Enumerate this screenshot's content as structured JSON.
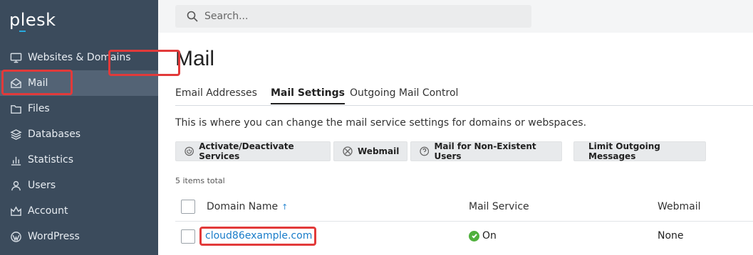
{
  "app": {
    "logo": "plesk"
  },
  "sidebar": {
    "items": [
      {
        "label": "Websites & Domains",
        "icon": "monitor-icon"
      },
      {
        "label": "Mail",
        "icon": "mail-icon",
        "active": true
      },
      {
        "label": "Files",
        "icon": "folder-icon"
      },
      {
        "label": "Databases",
        "icon": "database-icon"
      },
      {
        "label": "Statistics",
        "icon": "bar-chart-icon"
      },
      {
        "label": "Users",
        "icon": "user-icon"
      },
      {
        "label": "Account",
        "icon": "account-icon"
      },
      {
        "label": "WordPress",
        "icon": "wordpress-icon"
      }
    ]
  },
  "search": {
    "placeholder": "Search..."
  },
  "page": {
    "title": "Mail",
    "tabs": [
      {
        "label": "Email Addresses"
      },
      {
        "label": "Mail Settings",
        "active": true
      },
      {
        "label": "Outgoing Mail Control"
      }
    ],
    "description": "This is where you can change the mail service settings for domains or webspaces.",
    "toolbar": {
      "activate": "Activate/Deactivate Services",
      "webmail": "Webmail",
      "nonexistent": "Mail for Non-Existent Users",
      "limit": "Limit Outgoing Messages"
    },
    "items_total": "5 items total"
  },
  "table": {
    "columns": [
      "Domain Name",
      "Mail Service",
      "Webmail"
    ],
    "sort_indicator": "↑",
    "rows": [
      {
        "domain": "cloud86example.com",
        "mail_service": "On",
        "webmail": "None"
      }
    ]
  },
  "colors": {
    "sidebar_bg": "#3b4b5c",
    "highlight": "#e23a3a",
    "link": "#1a7cc9",
    "ok": "#4fb03c"
  }
}
